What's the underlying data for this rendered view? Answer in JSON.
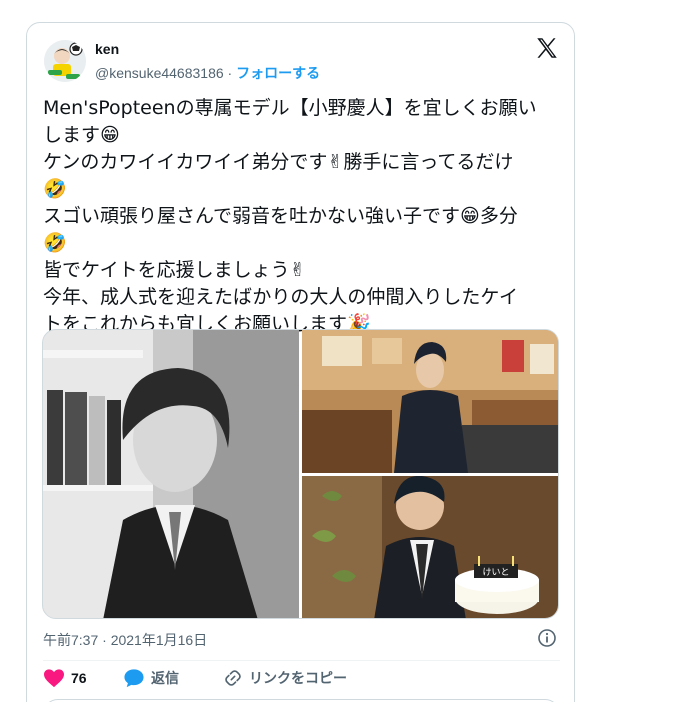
{
  "tweet": {
    "author_name": "ken",
    "handle": "@kensuke44683186",
    "separator": "·",
    "follow_label": "フォローする",
    "lines": [
      "Men'sPopteenの専属モデル【小野慶人】を宜しくお願い",
      "します😁",
      "ケンのカワイイカワイイ弟分です✌勝手に言ってるだけ",
      "🤣",
      "スゴい頑張り屋さんで弱音を吐かない強い子です😁多分",
      "🤣",
      "皆でケイトを応援しましょう✌",
      "今年、成人式を迎えたばかりの大人の仲間入りしたケイ",
      "トをこれからも宜しくお願いします🎉"
    ],
    "photos": [
      "photo-1",
      "photo-2",
      "photo-3"
    ],
    "cake_sign": "けいと",
    "timestamp": "午前7:37 · 2021年1月16日",
    "like_count": "76",
    "reply_label": "返信",
    "copy_link_label": "リンクをコピー"
  },
  "colors": {
    "accent": "#1d9bf0",
    "like": "#f91880",
    "muted": "#536471",
    "border": "#cfd9de"
  },
  "icons": [
    "x-logo-icon",
    "info-icon",
    "heart-icon",
    "reply-icon",
    "link-icon"
  ]
}
